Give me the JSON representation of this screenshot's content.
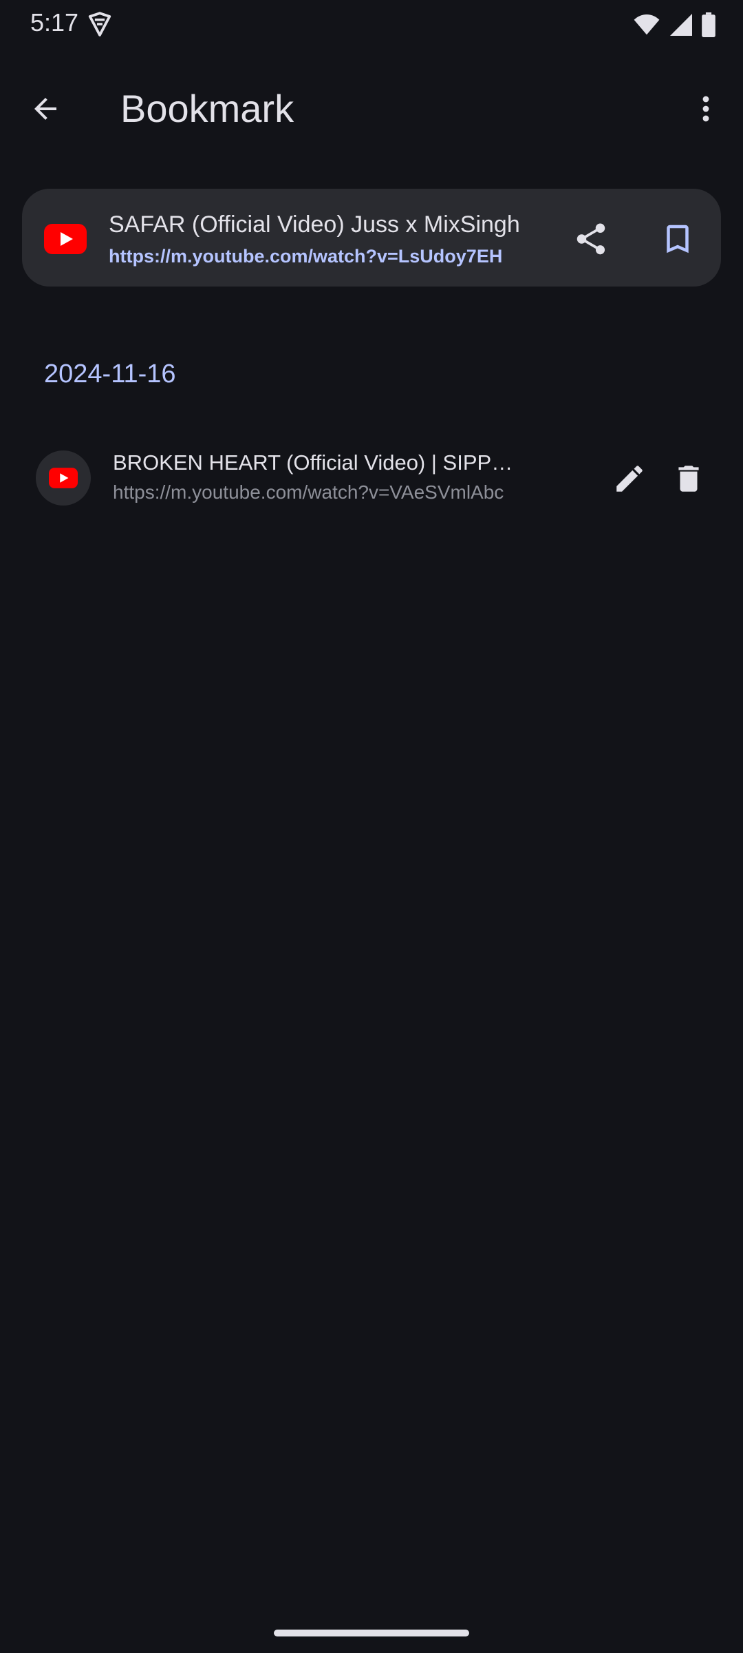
{
  "status_bar": {
    "time": "5:17",
    "icons": [
      "vpn-shield-icon",
      "wifi-icon",
      "cellular-signal-icon",
      "battery-icon"
    ]
  },
  "app_bar": {
    "title": "Bookmark",
    "back_icon": "arrow-back-icon",
    "more_icon": "more-vert-icon"
  },
  "current_page": {
    "favicon": "youtube-logo",
    "title": "SAFAR (Official Video) Juss x MixSingh",
    "url": "https://m.youtube.com/watch?v=LsUdoy7EH",
    "share_icon": "share-icon",
    "bookmark_icon": "bookmark-outline-icon"
  },
  "bookmark_groups": [
    {
      "date": "2024-11-16",
      "items": [
        {
          "favicon": "youtube-logo",
          "title": "BROKEN HEART (Official Video) | SIPPY GILL",
          "url": "https://m.youtube.com/watch?v=VAeSVmlAbc",
          "edit_icon": "edit-pencil-icon",
          "delete_icon": "delete-trash-icon"
        }
      ]
    }
  ],
  "colors": {
    "background": "#121318",
    "card": "#2a2b30",
    "accent": "#b5c4ff",
    "text_primary": "#e3e2e9",
    "text_secondary": "#8e9099",
    "youtube_red": "#ff0000"
  }
}
